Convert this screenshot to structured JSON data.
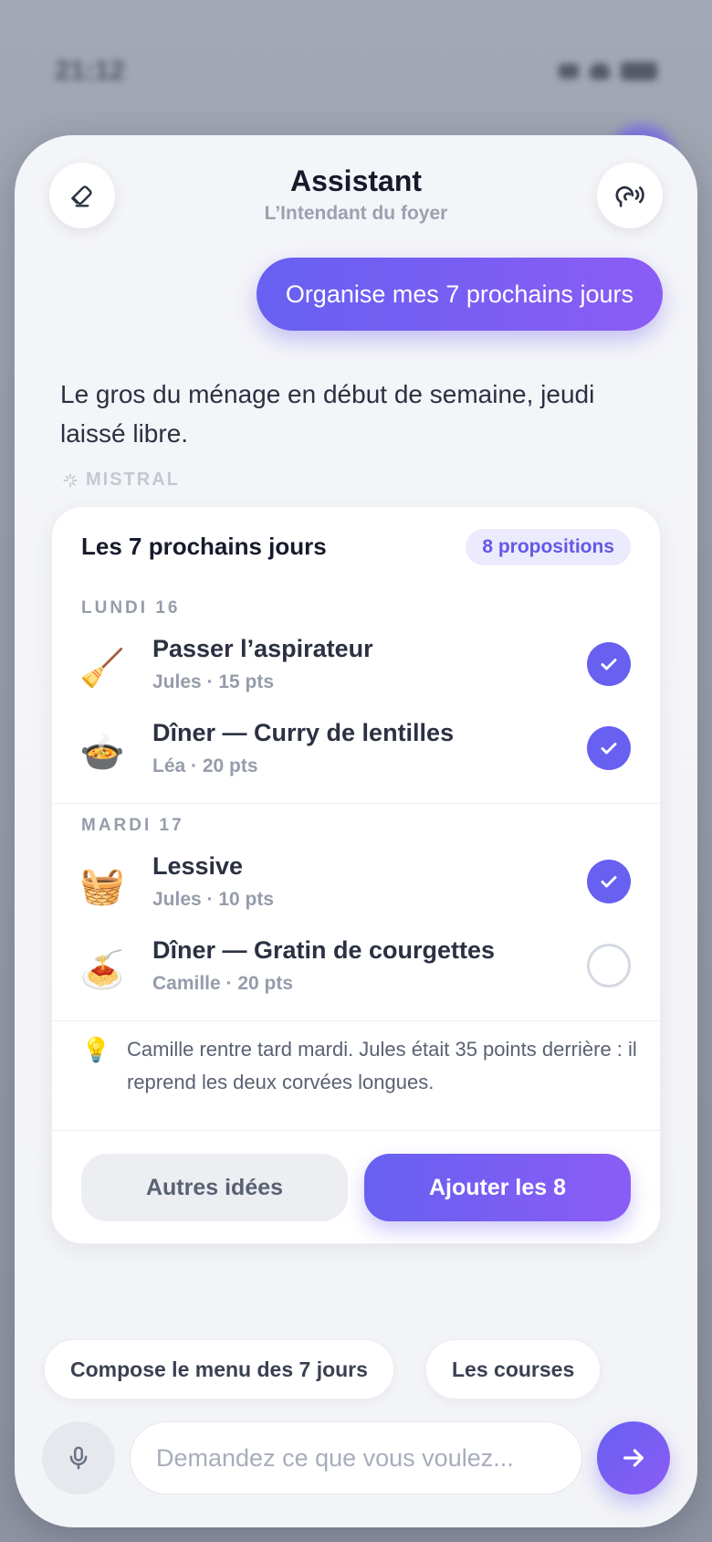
{
  "background": {
    "status_time": "21:12"
  },
  "header": {
    "title": "Assistant",
    "subtitle": "L’Intendant du foyer",
    "clear_icon": "eraser-icon",
    "voice_icon": "voice-wave-icon"
  },
  "conversation": {
    "user_message": "Organise mes 7 prochains jours",
    "assistant_message": "Le gros du ménage en début de semaine, jeudi laissé libre.",
    "model_tag": "MISTRAL"
  },
  "plan_card": {
    "title": "Les 7 prochains jours",
    "badge": "8 propositions",
    "days": [
      {
        "label": "LUNDI 16",
        "tasks": [
          {
            "emoji": "🧹",
            "name": "Passer l’aspirateur",
            "meta": "Jules · 15 pts",
            "checked": true
          },
          {
            "emoji": "🍲",
            "name": "Dîner — Curry de lentilles",
            "meta": "Léa · 20 pts",
            "checked": true
          }
        ]
      },
      {
        "label": "MARDI 17",
        "tasks": [
          {
            "emoji": "🧺",
            "name": "Lessive",
            "meta": "Jules · 10 pts",
            "checked": true
          },
          {
            "emoji": "🍝",
            "name": "Dîner — Gratin de courgettes",
            "meta": "Camille · 20 pts",
            "checked": false
          }
        ]
      }
    ],
    "tip_icon": "lightbulb-icon",
    "tip": "Camille rentre tard mardi. Jules était 35 points derrière : il reprend les deux corvées longues.",
    "secondary_button": "Autres idées",
    "primary_button": "Ajouter les 8"
  },
  "suggestions": [
    "Compose le menu des 7 jours",
    "Les courses"
  ],
  "composer": {
    "placeholder": "Demandez ce que vous voulez...",
    "mic_icon": "microphone-icon",
    "send_icon": "arrow-right-icon"
  },
  "colors": {
    "accent": "#6760f1",
    "accent_end": "#8b5cf6",
    "text_dark": "#161a2b",
    "text_muted": "#959cab"
  }
}
